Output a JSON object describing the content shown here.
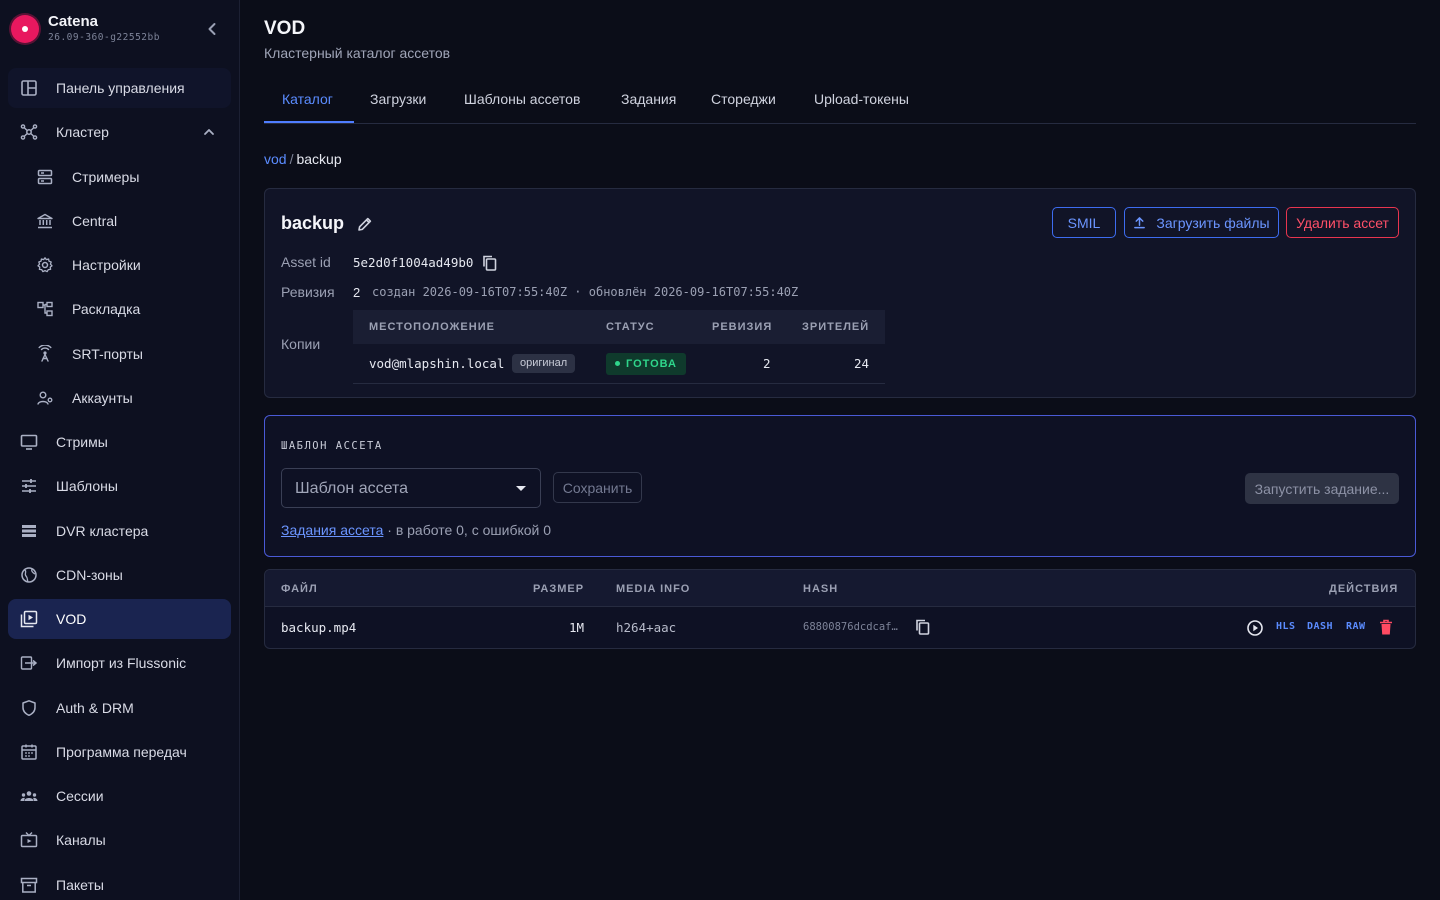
{
  "app": {
    "name": "Catena",
    "version": "26.09-360-g22552bb"
  },
  "sidebar": {
    "items": [
      {
        "label": "Панель управления",
        "icon": "dashboard-icon"
      },
      {
        "label": "Кластер",
        "icon": "cluster-icon",
        "expanded": true
      },
      {
        "label": "Стримеры",
        "icon": "server-icon",
        "sub": true
      },
      {
        "label": "Central",
        "icon": "bank-icon",
        "sub": true
      },
      {
        "label": "Настройки",
        "icon": "gear-icon",
        "sub": true
      },
      {
        "label": "Раскладка",
        "icon": "layout-icon",
        "sub": true
      },
      {
        "label": "SRT-порты",
        "icon": "antenna-icon",
        "sub": true
      },
      {
        "label": "Аккаунты",
        "icon": "accounts-icon",
        "sub": true
      },
      {
        "label": "Стримы",
        "icon": "monitor-icon"
      },
      {
        "label": "Шаблоны",
        "icon": "sliders-icon"
      },
      {
        "label": "DVR кластера",
        "icon": "list-icon"
      },
      {
        "label": "CDN-зоны",
        "icon": "globe-icon"
      },
      {
        "label": "VOD",
        "icon": "vod-icon",
        "active": true
      },
      {
        "label": "Импорт из Flussonic",
        "icon": "import-icon"
      },
      {
        "label": "Auth & DRM",
        "icon": "shield-icon"
      },
      {
        "label": "Программа передач",
        "icon": "calendar-icon"
      },
      {
        "label": "Сессии",
        "icon": "users-icon"
      },
      {
        "label": "Каналы",
        "icon": "tv-icon"
      },
      {
        "label": "Пакеты",
        "icon": "archive-icon"
      }
    ]
  },
  "header": {
    "title": "VOD",
    "subtitle": "Кластерный каталог ассетов"
  },
  "tabs": [
    {
      "label": "Каталог",
      "active": true
    },
    {
      "label": "Загрузки"
    },
    {
      "label": "Шаблоны ассетов"
    },
    {
      "label": "Задания"
    },
    {
      "label": "Стореджи"
    },
    {
      "label": "Upload-токены"
    }
  ],
  "breadcrumb": {
    "root": "vod",
    "sep": "/",
    "current": "backup"
  },
  "asset": {
    "name": "backup",
    "buttons": {
      "smil": "SMIL",
      "upload": "Загрузить файлы",
      "delete": "Удалить ассет"
    },
    "id_label": "Asset id",
    "id": "5e2d0f1004ad49b0",
    "revision_label": "Ревизия",
    "revision": "2",
    "revision_meta": "создан 2026-09-16T07:55:40Z · обновлён 2026-09-16T07:55:40Z",
    "copies_label": "Копии",
    "copies": {
      "columns": [
        "МЕСТОПОЛОЖЕНИЕ",
        "СТАТУС",
        "РЕВИЗИЯ",
        "ЗРИТЕЛЕЙ"
      ],
      "rows": [
        {
          "location": "vod@mlapshin.local",
          "badge": "оригинал",
          "status": "ГОТОВА",
          "revision": "2",
          "viewers": "24"
        }
      ]
    }
  },
  "template": {
    "caption": "ШАБЛОН АССЕТА",
    "select_placeholder": "Шаблон ассета",
    "save": "Сохранить",
    "run": "Запустить задание...",
    "jobs_link": "Задания ассета",
    "jobs_status": "· в работе 0, с ошибкой 0"
  },
  "files": {
    "columns": [
      "ФАЙЛ",
      "РАЗМЕР",
      "MEDIA INFO",
      "HASH",
      "ДЕЙСТВИЯ"
    ],
    "rows": [
      {
        "file": "backup.mp4",
        "size": "1M",
        "media": "h264+aac",
        "hash": "68800876dcdcaf…",
        "actions": [
          "HLS",
          "DASH",
          "RAW"
        ]
      }
    ]
  },
  "colors": {
    "accent": "#4f7dff",
    "danger": "#e8354f",
    "success": "#2fd68b",
    "brand": "#e8185f"
  }
}
